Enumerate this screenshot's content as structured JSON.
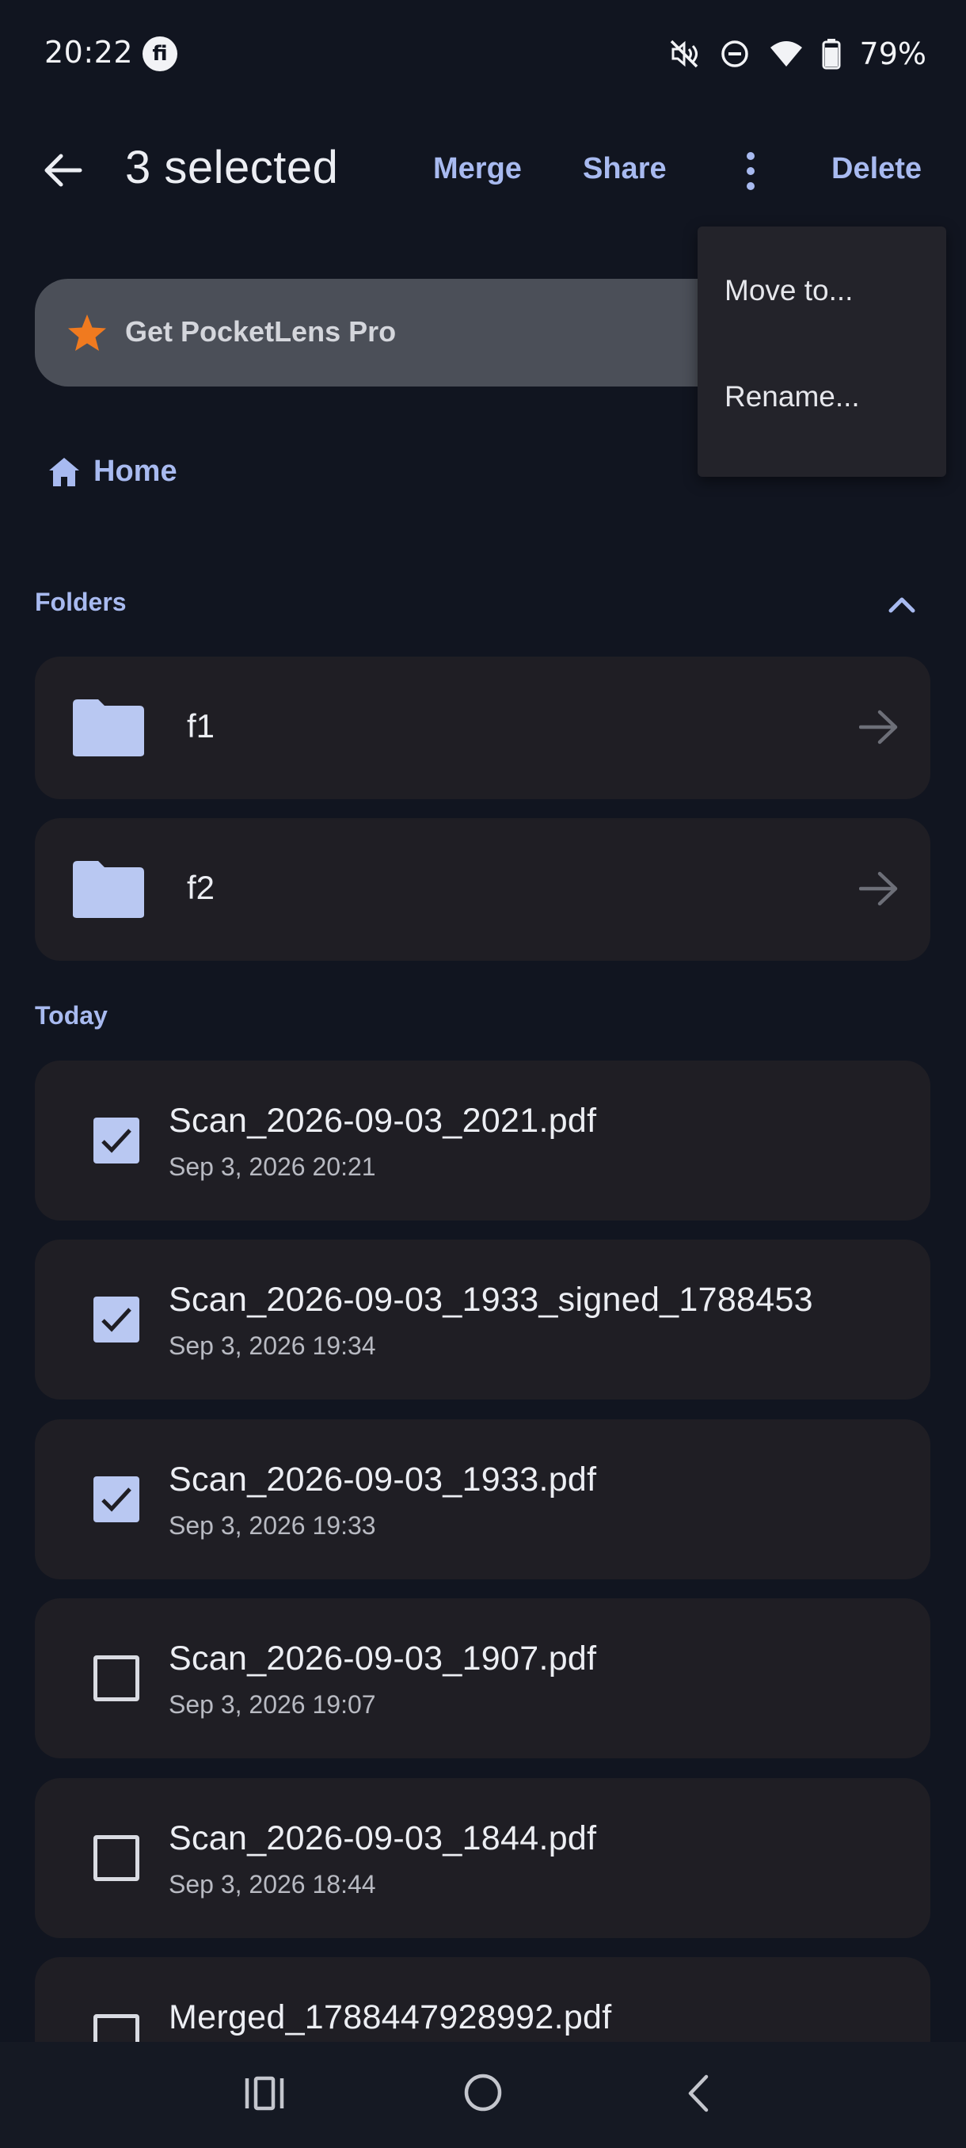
{
  "status_bar": {
    "time": "20:22",
    "app_icon_letter": "fi",
    "battery": "79%",
    "icons": [
      "mute-vibrate-icon",
      "do-not-disturb-icon",
      "wifi-icon",
      "battery-icon"
    ]
  },
  "app_bar": {
    "title": "3 selected",
    "merge_label": "Merge",
    "share_label": "Share",
    "delete_label": "Delete"
  },
  "promo": {
    "label": "Get PocketLens Pro"
  },
  "menu": {
    "items": [
      "Move to...",
      "Rename..."
    ]
  },
  "breadcrumb": {
    "home_label": "Home"
  },
  "sections": {
    "folders_label": "Folders",
    "today_label": "Today"
  },
  "folders": [
    {
      "name": "f1"
    },
    {
      "name": "f2"
    }
  ],
  "files": [
    {
      "name": "Scan_2026-09-03_2021.pdf",
      "date": "Sep 3, 2026 20:21",
      "checked": true
    },
    {
      "name": "Scan_2026-09-03_1933_signed_1788453",
      "date": "Sep 3, 2026 19:34",
      "checked": true
    },
    {
      "name": "Scan_2026-09-03_1933.pdf",
      "date": "Sep 3, 2026 19:33",
      "checked": true
    },
    {
      "name": "Scan_2026-09-03_1907.pdf",
      "date": "Sep 3, 2026 19:07",
      "checked": false
    },
    {
      "name": "Scan_2026-09-03_1844.pdf",
      "date": "Sep 3, 2026 18:44",
      "checked": false
    },
    {
      "name": "Merged_1788447928992.pdf",
      "date": "",
      "checked": false
    }
  ],
  "colors": {
    "background": "#111520",
    "accent": "#a8baf0",
    "card": "#1f1e24",
    "promo_bg": "#4b4f58",
    "star": "#f07a1f",
    "folder": "#b9c8f2"
  }
}
